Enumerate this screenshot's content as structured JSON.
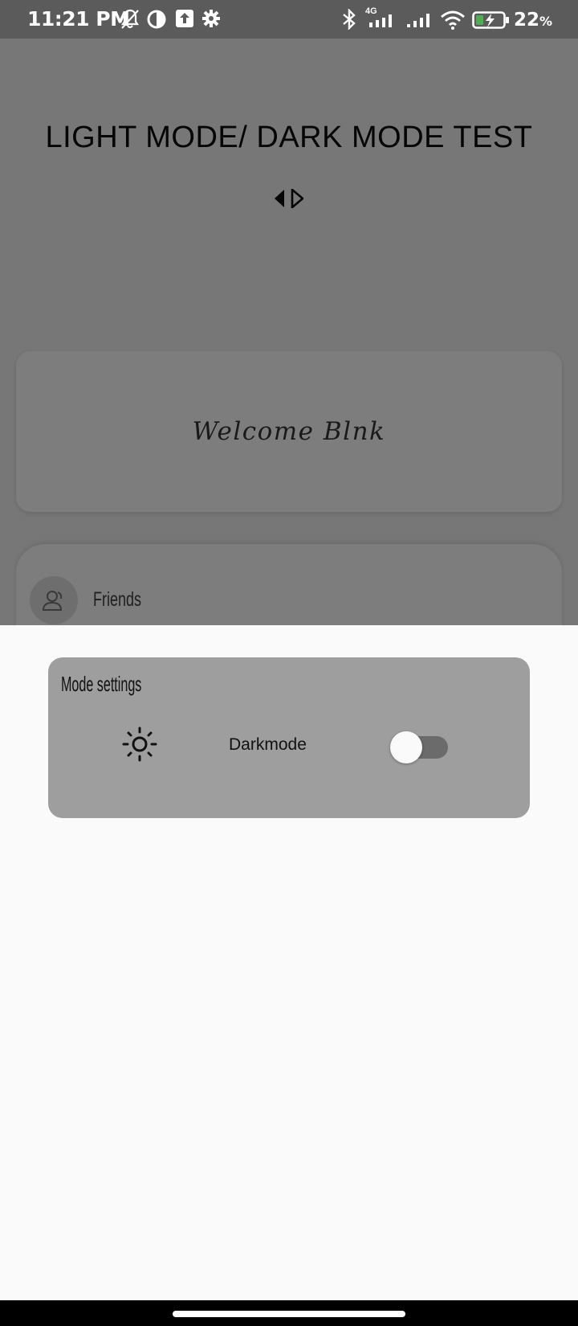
{
  "status_bar": {
    "time": "11:21 PM",
    "network": "4G",
    "battery_percent": "22",
    "battery_unit": "%",
    "icons": [
      "muted-bell-icon",
      "data-saver-icon",
      "upload-icon",
      "settings-gear-icon",
      "bluetooth-icon",
      "signal-icon",
      "signal-icon",
      "wifi-icon",
      "battery-charging-icon"
    ],
    "battery_color": "#4caf50"
  },
  "main": {
    "title": "LIGHT MODE/ DARK MODE TEST",
    "welcome_text": "Welcome Blnk",
    "list": [
      {
        "label": "Friends",
        "icon": "friends-icon"
      }
    ]
  },
  "sheet": {
    "card_title": "Mode settings",
    "icon": "sun-icon",
    "toggle_label": "Darkmode",
    "toggle_on": false
  },
  "colors": {
    "scrim_background": "#777777",
    "sheet_background": "#fafafa",
    "card_background": "#9e9e9e"
  }
}
